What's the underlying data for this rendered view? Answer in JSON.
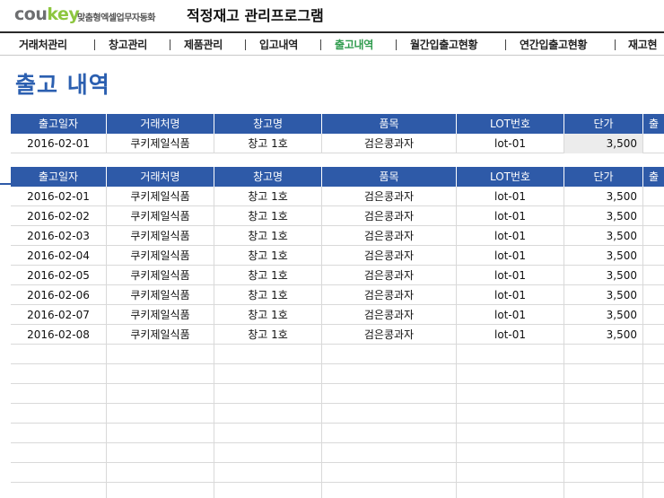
{
  "brand": {
    "logo_part1": "cou",
    "logo_part2": "key",
    "tagline": "맞춤형엑셀업무자동화"
  },
  "app_title": "적정재고 관리프로그램",
  "nav": [
    {
      "label": "거래처관리",
      "active": false
    },
    {
      "label": "창고관리",
      "active": false
    },
    {
      "label": "제품관리",
      "active": false
    },
    {
      "label": "입고내역",
      "active": false
    },
    {
      "label": "출고내역",
      "active": true
    },
    {
      "label": "월간입출고현황",
      "active": false
    },
    {
      "label": "연간입출고현황",
      "active": false
    },
    {
      "label": "재고현",
      "active": false
    }
  ],
  "page_title": "출고 내역",
  "columns": [
    "출고일자",
    "거래처명",
    "창고명",
    "품목",
    "LOT번호",
    "단가",
    "출"
  ],
  "input_row": {
    "date": "2016-02-01",
    "client": "쿠키제일식품",
    "warehouse": "창고 1호",
    "item": "검은콩과자",
    "lot": "lot-01",
    "price": "3,500"
  },
  "rows": [
    {
      "date": "2016-02-01",
      "client": "쿠키제일식품",
      "warehouse": "창고 1호",
      "item": "검은콩과자",
      "lot": "lot-01",
      "price": "3,500"
    },
    {
      "date": "2016-02-02",
      "client": "쿠키제일식품",
      "warehouse": "창고 1호",
      "item": "검은콩과자",
      "lot": "lot-01",
      "price": "3,500"
    },
    {
      "date": "2016-02-03",
      "client": "쿠키제일식품",
      "warehouse": "창고 1호",
      "item": "검은콩과자",
      "lot": "lot-01",
      "price": "3,500"
    },
    {
      "date": "2016-02-04",
      "client": "쿠키제일식품",
      "warehouse": "창고 1호",
      "item": "검은콩과자",
      "lot": "lot-01",
      "price": "3,500"
    },
    {
      "date": "2016-02-05",
      "client": "쿠키제일식품",
      "warehouse": "창고 1호",
      "item": "검은콩과자",
      "lot": "lot-01",
      "price": "3,500"
    },
    {
      "date": "2016-02-06",
      "client": "쿠키제일식품",
      "warehouse": "창고 1호",
      "item": "검은콩과자",
      "lot": "lot-01",
      "price": "3,500"
    },
    {
      "date": "2016-02-07",
      "client": "쿠키제일식품",
      "warehouse": "창고 1호",
      "item": "검은콩과자",
      "lot": "lot-01",
      "price": "3,500"
    },
    {
      "date": "2016-02-08",
      "client": "쿠키제일식품",
      "warehouse": "창고 1호",
      "item": "검은콩과자",
      "lot": "lot-01",
      "price": "3,500"
    }
  ],
  "colors": {
    "header_bg": "#2e5aa8",
    "title": "#2b5fb0",
    "nav_active": "#2f9b4d",
    "grid": "#d9d9d9"
  }
}
